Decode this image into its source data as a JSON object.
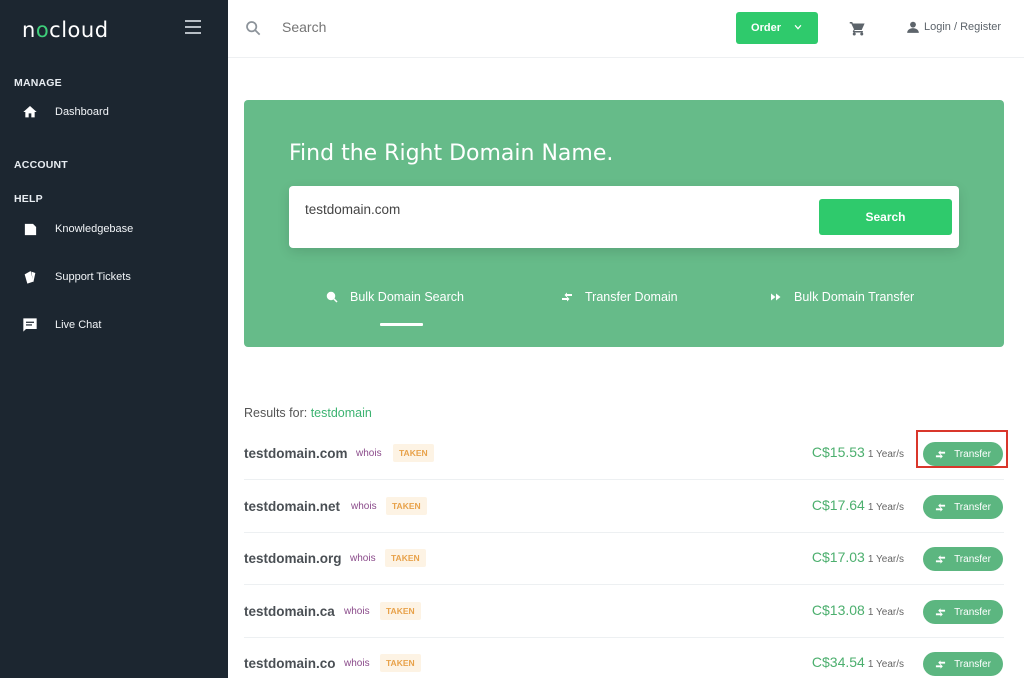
{
  "brand": {
    "logo_text_before": "n",
    "logo_text_accent": "o",
    "logo_text_after": "cloud"
  },
  "sidebar": {
    "sections": {
      "manage": "MANAGE",
      "account": "ACCOUNT",
      "help": "HELP"
    },
    "items": [
      {
        "label": "Dashboard",
        "icon": "home-icon"
      },
      {
        "label": "Knowledgebase",
        "icon": "document-icon"
      },
      {
        "label": "Support Tickets",
        "icon": "ticket-icon"
      },
      {
        "label": "Live Chat",
        "icon": "chat-icon"
      }
    ]
  },
  "topbar": {
    "search_placeholder": "Search",
    "order_label": "Order",
    "login_label": "Login / Register"
  },
  "hero": {
    "title": "Find the Right Domain Name.",
    "search_value": "testdomain.com",
    "search_button": "Search",
    "tabs": [
      {
        "label": "Bulk Domain Search",
        "icon": "search-icon",
        "active": true
      },
      {
        "label": "Transfer Domain",
        "icon": "transfer-icon",
        "active": false
      },
      {
        "label": "Bulk Domain Transfer",
        "icon": "fast-forward-icon",
        "active": false
      }
    ]
  },
  "results": {
    "label": "Results for:",
    "term": "testdomain",
    "rows": [
      {
        "domain": "testdomain.com",
        "whois": "whois",
        "status": "TAKEN",
        "price": "C$15.53",
        "period": "1 Year/s",
        "action": "Transfer"
      },
      {
        "domain": "testdomain.net",
        "whois": "whois",
        "status": "TAKEN",
        "price": "C$17.64",
        "period": "1 Year/s",
        "action": "Transfer"
      },
      {
        "domain": "testdomain.org",
        "whois": "whois",
        "status": "TAKEN",
        "price": "C$17.03",
        "period": "1 Year/s",
        "action": "Transfer"
      },
      {
        "domain": "testdomain.ca",
        "whois": "whois",
        "status": "TAKEN",
        "price": "C$13.08",
        "period": "1 Year/s",
        "action": "Transfer"
      },
      {
        "domain": "testdomain.co",
        "whois": "whois",
        "status": "TAKEN",
        "price": "C$34.54",
        "period": "1 Year/s",
        "action": "Transfer"
      }
    ]
  },
  "colors": {
    "sidebar_bg": "#1c2630",
    "accent_green": "#2fca6c",
    "hero_green": "#66bb89",
    "highlight_red": "#d9362b"
  }
}
